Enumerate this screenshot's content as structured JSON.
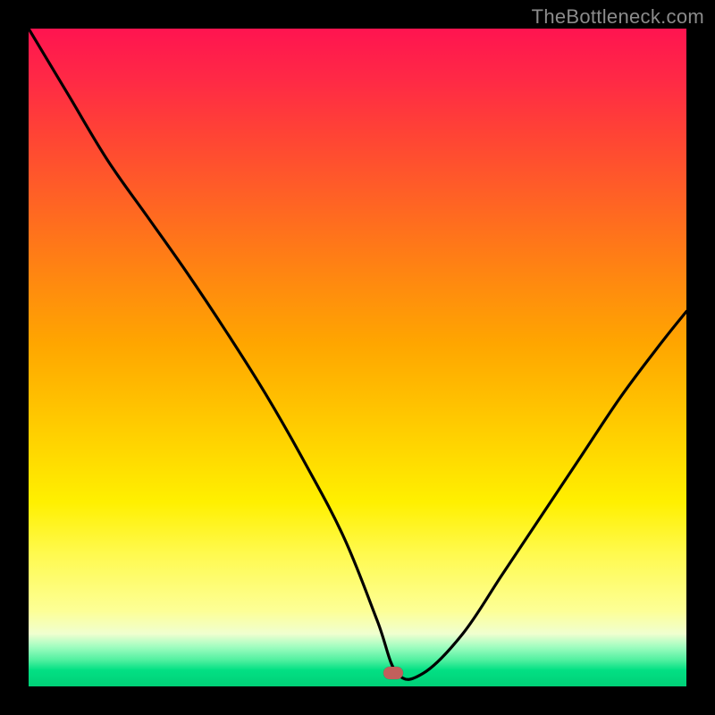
{
  "attribution": "TheBottleneck.com",
  "marker": {
    "x_pct": 55.5,
    "y_pct": 98
  },
  "chart_data": {
    "type": "line",
    "title": "",
    "xlabel": "",
    "ylabel": "",
    "xlim": [
      0,
      100
    ],
    "ylim": [
      0,
      100
    ],
    "grid": false,
    "series": [
      {
        "name": "bottleneck-curve",
        "x": [
          0,
          6,
          12,
          18,
          24,
          30,
          36,
          42,
          48,
          53,
          56,
          60,
          66,
          72,
          78,
          84,
          90,
          96,
          100
        ],
        "values": [
          100,
          90,
          80,
          71.5,
          63,
          54,
          44.5,
          34,
          22.5,
          10,
          2,
          2,
          8,
          17,
          26,
          35,
          44,
          52,
          57
        ]
      }
    ],
    "annotations": [
      {
        "text": "TheBottleneck.com",
        "position": "top-right"
      }
    ],
    "marker_point": {
      "x": 55.5,
      "y": 2
    }
  }
}
